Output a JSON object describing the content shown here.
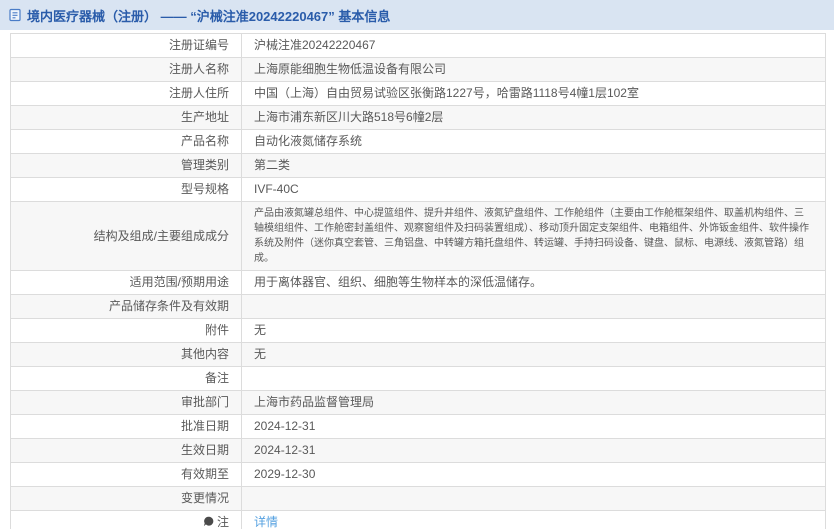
{
  "header": {
    "icon": "document-icon",
    "title": "境内医疗器械（注册） —— “沪械注准20242220467” 基本信息"
  },
  "colors": {
    "header_bg": "#d9e4f2",
    "header_text": "#2a5caa",
    "row_alt": "#f7f7f7",
    "border": "#dcdcdc",
    "text": "#595959",
    "link": "#54a0e0"
  },
  "table": {
    "rows": [
      {
        "label": "注册证编号",
        "value": "沪械注准20242220467",
        "type": "text"
      },
      {
        "label": "注册人名称",
        "value": "上海原能细胞生物低温设备有限公司",
        "type": "text"
      },
      {
        "label": "注册人住所",
        "value": "中国（上海）自由贸易试验区张衡路1227号，哈雷路1118号4幢1层102室",
        "type": "text"
      },
      {
        "label": "生产地址",
        "value": "上海市浦东新区川大路518号6幢2层",
        "type": "text"
      },
      {
        "label": "产品名称",
        "value": "自动化液氮储存系统",
        "type": "text"
      },
      {
        "label": "管理类别",
        "value": "第二类",
        "type": "text"
      },
      {
        "label": "型号规格",
        "value": "IVF-40C",
        "type": "text"
      },
      {
        "label": "结构及组成/主要组成成分",
        "value": "产品由液氮罐总组件、中心提篮组件、提升井组件、液氮铲盘组件、工作舱组件（主要由工作舱框架组件、取盖机构组件、三轴模组组件、工作舱密封盖组件、观察窗组件及扫码装置组成）、移动顶升固定支架组件、电箱组件、外饰钣金组件、软件操作系统及附件（迷你真空套管、三角铝盘、中转罐方箱托盘组件、转运罐、手持扫码设备、键盘、鼠标、电源线、液氮管路）组成。",
        "type": "text"
      },
      {
        "label": "适用范围/预期用途",
        "value": "用于离体器官、组织、细胞等生物样本的深低温储存。",
        "type": "text"
      },
      {
        "label": "产品储存条件及有效期",
        "value": "",
        "type": "text"
      },
      {
        "label": "附件",
        "value": "无",
        "type": "text"
      },
      {
        "label": "其他内容",
        "value": "无",
        "type": "text"
      },
      {
        "label": "备注",
        "value": "",
        "type": "text"
      },
      {
        "label": "审批部门",
        "value": "上海市药品监督管理局",
        "type": "text"
      },
      {
        "label": "批准日期",
        "value": "2024-12-31",
        "type": "text"
      },
      {
        "label": "生效日期",
        "value": "2024-12-31",
        "type": "text"
      },
      {
        "label": "有效期至",
        "value": "2029-12-30",
        "type": "text"
      },
      {
        "label": "变更情况",
        "value": "",
        "type": "text"
      },
      {
        "label": "注",
        "label_icon": "note-icon",
        "value": "详情",
        "type": "link"
      }
    ]
  }
}
